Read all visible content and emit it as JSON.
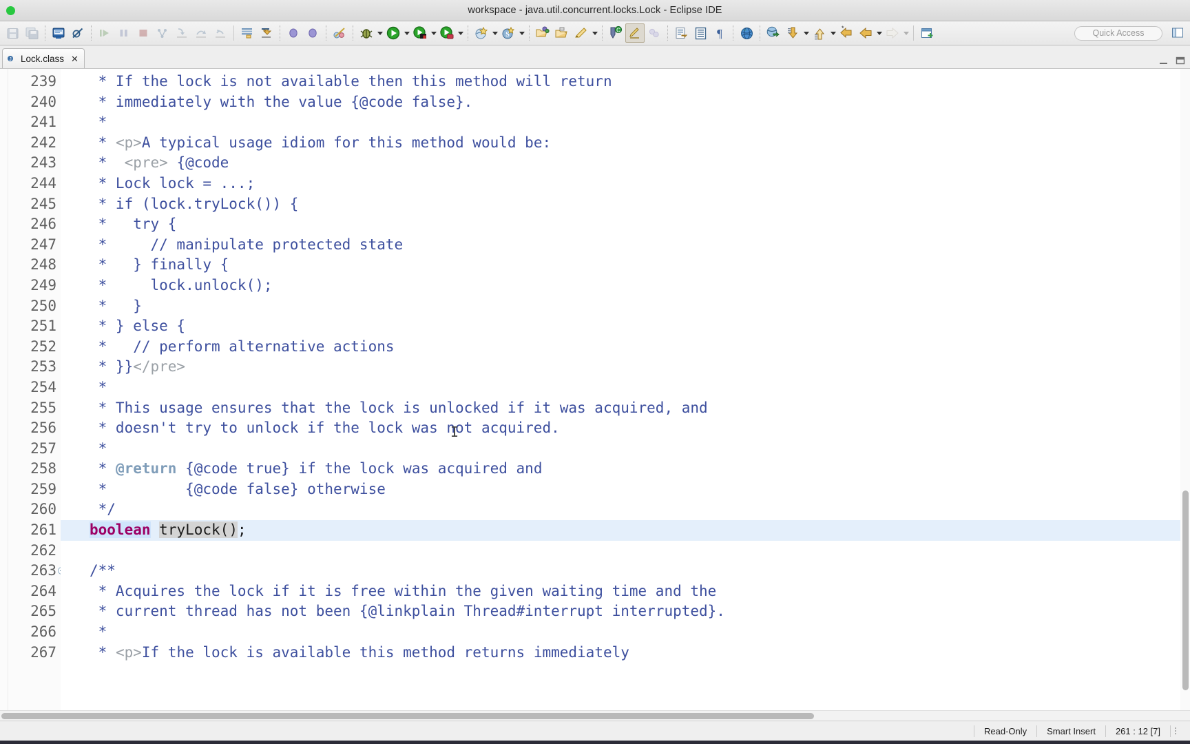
{
  "window": {
    "title": "workspace - java.util.concurrent.locks.Lock - Eclipse IDE",
    "traffic_lights": [
      "close",
      "minimize",
      "zoom"
    ]
  },
  "toolbar": {
    "quick_access_placeholder": "Quick Access",
    "items": [
      {
        "name": "save-icon",
        "enabled": false
      },
      {
        "name": "save-all-icon",
        "enabled": false
      },
      {
        "name": "new-java-class-icon",
        "enabled": true
      },
      {
        "name": "skip-all-breakpoints-icon",
        "enabled": true
      },
      {
        "name": "resume-icon",
        "enabled": false
      },
      {
        "name": "suspend-icon",
        "enabled": false
      },
      {
        "name": "terminate-icon",
        "enabled": false
      },
      {
        "name": "disconnect-icon",
        "enabled": false
      },
      {
        "name": "step-into-icon",
        "enabled": false
      },
      {
        "name": "step-over-icon",
        "enabled": false
      },
      {
        "name": "step-return-icon",
        "enabled": false
      },
      {
        "name": "next-annotation-icon",
        "enabled": true
      },
      {
        "name": "previous-annotation-icon",
        "enabled": true
      },
      {
        "name": "toggle-mark-occurrences-icon",
        "enabled": true
      },
      {
        "name": "toggle-breadcrumb-icon",
        "enabled": true
      },
      {
        "name": "debug-last-launched-icon",
        "enabled": true
      },
      {
        "name": "debug-dropdown-icon",
        "enabled": true
      },
      {
        "name": "run-icon",
        "enabled": true
      },
      {
        "name": "run-dropdown-icon",
        "enabled": true
      },
      {
        "name": "coverage-icon",
        "enabled": true
      },
      {
        "name": "coverage-dropdown-icon",
        "enabled": true
      },
      {
        "name": "external-tools-icon",
        "enabled": true
      },
      {
        "name": "external-tools-dropdown-icon",
        "enabled": true
      },
      {
        "name": "new-icon",
        "enabled": true
      },
      {
        "name": "new-dropdown-icon",
        "enabled": true
      },
      {
        "name": "search-icon",
        "enabled": true
      },
      {
        "name": "search-dropdown-icon",
        "enabled": true
      },
      {
        "name": "open-type-icon",
        "enabled": true
      },
      {
        "name": "open-task-icon",
        "enabled": true
      },
      {
        "name": "new-annotation-icon",
        "enabled": true
      },
      {
        "name": "new-annotation-dropdown-icon",
        "enabled": true
      },
      {
        "name": "git-staging-icon",
        "enabled": true
      },
      {
        "name": "toggle-highlight-icon",
        "enabled": true,
        "active": true
      },
      {
        "name": "link-with-editor-icon",
        "enabled": false
      },
      {
        "name": "open-task-editor-icon",
        "enabled": true
      },
      {
        "name": "toggle-block-selection-icon",
        "enabled": true
      },
      {
        "name": "show-whitespace-icon",
        "enabled": true
      },
      {
        "name": "open-web-browser-icon",
        "enabled": true
      },
      {
        "name": "open-perspective-icon",
        "enabled": true
      },
      {
        "name": "next-edit-location-icon",
        "enabled": true
      },
      {
        "name": "next-edit-dropdown-icon",
        "enabled": true
      },
      {
        "name": "previous-edit-location-icon",
        "enabled": true
      },
      {
        "name": "previous-edit-dropdown-icon",
        "enabled": true
      },
      {
        "name": "last-edit-location-icon",
        "enabled": true
      },
      {
        "name": "back-icon",
        "enabled": true
      },
      {
        "name": "back-dropdown-icon",
        "enabled": true
      },
      {
        "name": "forward-icon",
        "enabled": false
      },
      {
        "name": "forward-dropdown-icon",
        "enabled": false
      },
      {
        "name": "new-window-icon",
        "enabled": true
      }
    ]
  },
  "editor_tabs": [
    {
      "label": "Lock.class",
      "close_glyph": "✕",
      "active": true
    }
  ],
  "window_controls": {
    "minimize_label": "Minimize",
    "maximize_label": "Maximize"
  },
  "editor": {
    "first_line": 239,
    "current_line": 261,
    "fold_lines": [
      263
    ],
    "lines": [
      {
        "no": 239,
        "segments": [
          {
            "t": " * If the lock is not available then this method will return",
            "c": "cmt"
          }
        ]
      },
      {
        "no": 240,
        "segments": [
          {
            "t": " * immediately with the value {@code false}.",
            "c": "cmt"
          }
        ]
      },
      {
        "no": 241,
        "segments": [
          {
            "t": " *",
            "c": "cmt"
          }
        ]
      },
      {
        "no": 242,
        "segments": [
          {
            "t": " * ",
            "c": "cmt"
          },
          {
            "t": "<p>",
            "c": "html-tag"
          },
          {
            "t": "A typical usage idiom for this method would be:",
            "c": "cmt"
          }
        ]
      },
      {
        "no": 243,
        "segments": [
          {
            "t": " *  ",
            "c": "cmt"
          },
          {
            "t": "<pre>",
            "c": "html-tag"
          },
          {
            "t": " {@code",
            "c": "cmt"
          }
        ]
      },
      {
        "no": 244,
        "segments": [
          {
            "t": " * Lock lock = ...;",
            "c": "cmt"
          }
        ]
      },
      {
        "no": 245,
        "segments": [
          {
            "t": " * if (lock.tryLock()) {",
            "c": "cmt"
          }
        ]
      },
      {
        "no": 246,
        "segments": [
          {
            "t": " *   try {",
            "c": "cmt"
          }
        ]
      },
      {
        "no": 247,
        "segments": [
          {
            "t": " *     // manipulate protected state",
            "c": "cmt"
          }
        ]
      },
      {
        "no": 248,
        "segments": [
          {
            "t": " *   } finally {",
            "c": "cmt"
          }
        ]
      },
      {
        "no": 249,
        "segments": [
          {
            "t": " *     lock.unlock();",
            "c": "cmt"
          }
        ]
      },
      {
        "no": 250,
        "segments": [
          {
            "t": " *   }",
            "c": "cmt"
          }
        ]
      },
      {
        "no": 251,
        "segments": [
          {
            "t": " * } else {",
            "c": "cmt"
          }
        ]
      },
      {
        "no": 252,
        "segments": [
          {
            "t": " *   // perform alternative actions",
            "c": "cmt"
          }
        ]
      },
      {
        "no": 253,
        "segments": [
          {
            "t": " * }}",
            "c": "cmt"
          },
          {
            "t": "</pre>",
            "c": "html-tag"
          }
        ]
      },
      {
        "no": 254,
        "segments": [
          {
            "t": " *",
            "c": "cmt"
          }
        ]
      },
      {
        "no": 255,
        "segments": [
          {
            "t": " * This usage ensures that the lock is unlocked if it was acquired, and",
            "c": "cmt"
          }
        ]
      },
      {
        "no": 256,
        "segments": [
          {
            "t": " * doesn't try to unlock if the lock was not acquired.",
            "c": "cmt"
          }
        ]
      },
      {
        "no": 257,
        "segments": [
          {
            "t": " *",
            "c": "cmt"
          }
        ]
      },
      {
        "no": 258,
        "segments": [
          {
            "t": " * ",
            "c": "cmt"
          },
          {
            "t": "@return",
            "c": "jdoc-tag"
          },
          {
            "t": " {@code true} if the lock was acquired and",
            "c": "cmt"
          }
        ]
      },
      {
        "no": 259,
        "segments": [
          {
            "t": " *         {@code false} otherwise",
            "c": "cmt"
          }
        ]
      },
      {
        "no": 260,
        "segments": [
          {
            "t": " */",
            "c": "cmt"
          }
        ]
      },
      {
        "no": 261,
        "current": true,
        "segments": [
          {
            "t": "boolean",
            "c": "kw"
          },
          {
            "t": " ",
            "c": "plain"
          },
          {
            "t": "tryLock()",
            "c": "occ"
          },
          {
            "t": ";",
            "c": "plain"
          }
        ]
      },
      {
        "no": 262,
        "segments": [
          {
            "t": "",
            "c": "plain"
          }
        ]
      },
      {
        "no": 263,
        "fold": true,
        "segments": [
          {
            "t": "/**",
            "c": "cmt"
          }
        ]
      },
      {
        "no": 264,
        "segments": [
          {
            "t": " * Acquires the lock if it is free within the given waiting time and the",
            "c": "cmt"
          }
        ]
      },
      {
        "no": 265,
        "segments": [
          {
            "t": " * current thread has not been {@linkplain Thread#interrupt interrupted}.",
            "c": "cmt"
          }
        ]
      },
      {
        "no": 266,
        "segments": [
          {
            "t": " *",
            "c": "cmt"
          }
        ]
      },
      {
        "no": 267,
        "segments": [
          {
            "t": " * ",
            "c": "cmt"
          },
          {
            "t": "<p>",
            "c": "html-tag"
          },
          {
            "t": "If the lock is available this method returns immediately",
            "c": "cmt"
          }
        ]
      }
    ],
    "colors": {
      "comment": "#3d4f9e",
      "html_tag": "#9aa0a6",
      "javadoc_tag": "#7f9db9",
      "keyword": "#9c0064",
      "keyword_selection_bg": "#cfe4fb",
      "occurrence_bg": "#d4d4d4",
      "current_line_bg": "#e4effb",
      "editor_bg": "#ffffff",
      "gutter_bg": "#fbfbfb",
      "line_number": "#5f5f5f"
    }
  },
  "statusbar": {
    "readonly": "Read-Only",
    "insert_mode": "Smart Insert",
    "position": "261 : 12 [7]"
  }
}
